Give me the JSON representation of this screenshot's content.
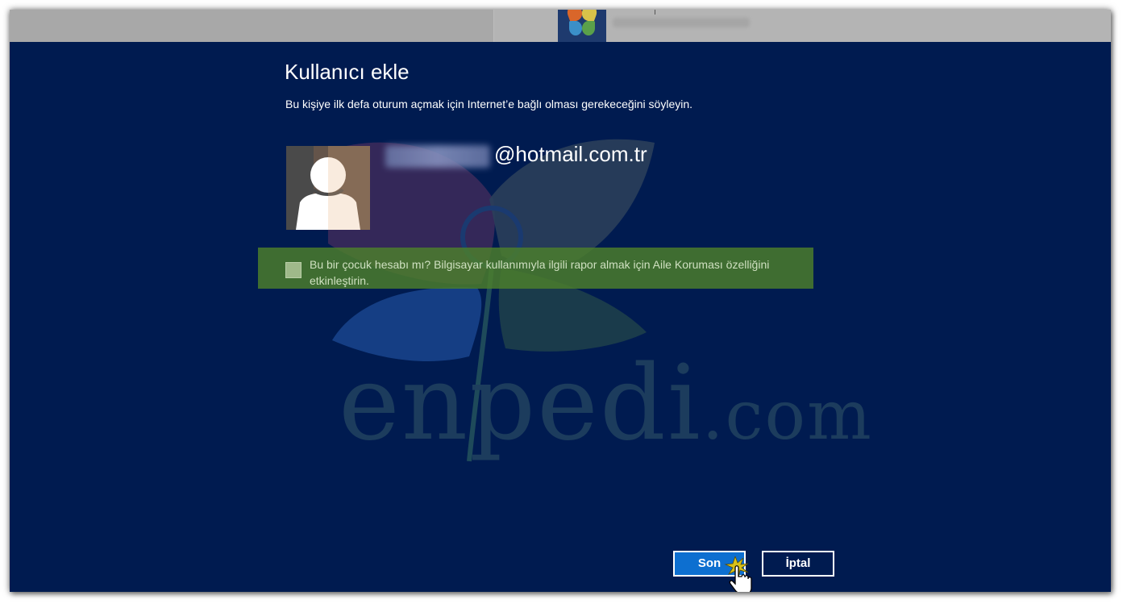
{
  "background_account": {
    "email_blurred": true
  },
  "dialog": {
    "title": "Kullanıcı ekle",
    "subtitle": "Bu kişiye ilk defa oturum açmak için Internet’e bağlı olması gerekeceğini söyleyin.",
    "account": {
      "username_blurred": true,
      "domain": "@hotmail.com.tr",
      "avatar_icon": "user-silhouette-icon"
    },
    "family_safety": {
      "checked": false,
      "label": "Bu bir çocuk hesabı mı? Bilgisayar kullanımıyla ilgili rapor almak için Aile Koruması özelliğini etkinleştirin."
    },
    "buttons": {
      "finish_label": "Son",
      "cancel_label": "İptal"
    }
  },
  "watermark": {
    "text": "enpedi",
    "suffix": ".com"
  },
  "colors": {
    "background": "#001b50",
    "family_box": "#4d802b",
    "primary_button": "#0d6fd0",
    "text": "#ffffff"
  }
}
